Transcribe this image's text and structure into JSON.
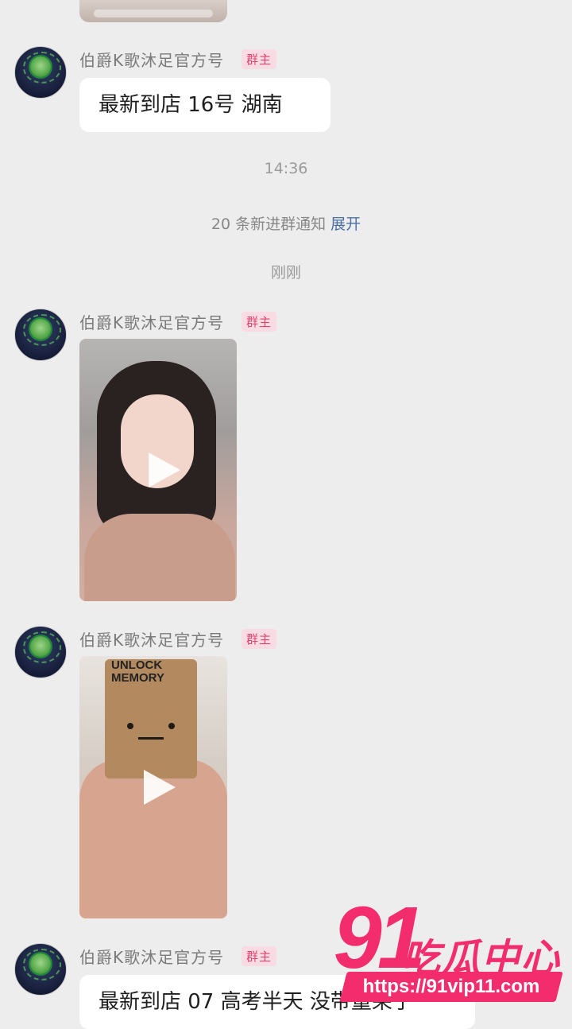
{
  "messages": [
    {
      "sender": "伯爵K歌沐足官方号",
      "role": "群主",
      "text": "最新到店  16号 湖南"
    },
    {
      "sender": "伯爵K歌沐足官方号",
      "role": "群主"
    },
    {
      "sender": "伯爵K歌沐足官方号",
      "role": "群主"
    },
    {
      "sender": "伯爵K歌沐足官方号",
      "role": "群主",
      "text": "最新到店  07 高考半天 没带童呆子"
    }
  ],
  "timestamps": {
    "first": "14:36",
    "second": "刚刚"
  },
  "notice": {
    "text": "20 条新进群通知",
    "action": "展开"
  },
  "video2_bag_text": "UNLOCK\nMEMORY",
  "watermark": {
    "number": "91",
    "name": "吃瓜中心",
    "url": "https://91vip11.com"
  },
  "colors": {
    "accent": "#f22c6d",
    "badge": "#e0446e",
    "link": "#4a6fa5",
    "background": "#ededed"
  }
}
